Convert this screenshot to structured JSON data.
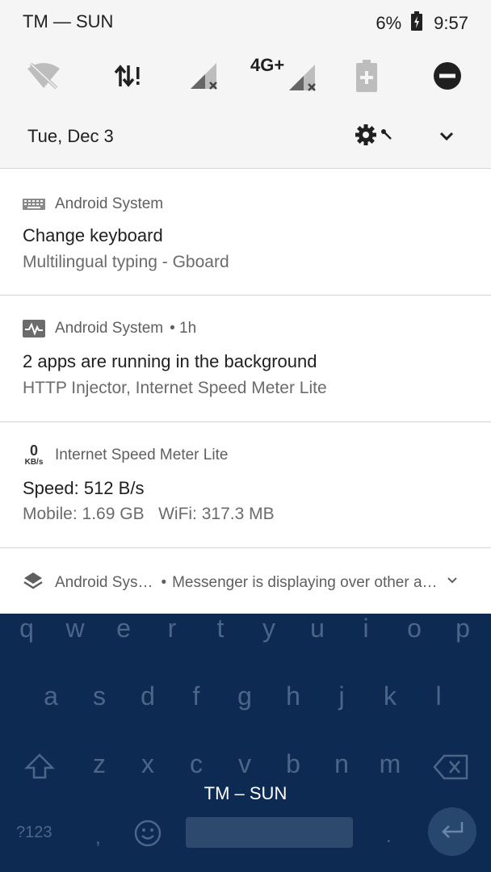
{
  "status_bar": {
    "carrier": "TM — SUN",
    "battery_percent": "6%",
    "time": "9:57"
  },
  "quick_settings": {
    "network_label": "4G+",
    "icons": [
      "wifi-off-icon",
      "data-transfer-icon",
      "signal-no-sim-icon",
      "signal-4g-icon",
      "battery-saver-icon",
      "do-not-disturb-icon"
    ]
  },
  "date_row": {
    "date": "Tue, Dec 3"
  },
  "notifications": [
    {
      "app": "Android System",
      "time": "",
      "title": "Change keyboard",
      "text": "Multilingual typing - Gboard",
      "icon": "keyboard-icon"
    },
    {
      "app": "Android System",
      "time": "• 1h",
      "title": "2 apps are running in the background",
      "text": "HTTP Injector, Internet Speed Meter Lite",
      "icon": "activity-icon"
    },
    {
      "app": "Internet Speed Meter Lite",
      "time": "",
      "title": "Speed: 512 B/s",
      "text": "Mobile: 1.69 GB   WiFi: 317.3 MB",
      "icon": "speed-icon",
      "icon_value": "0",
      "icon_unit": "KB/s"
    }
  ],
  "collapsed_notification": {
    "app": "Android Sys…",
    "separator": "•",
    "text": "Messenger is displaying over other a…",
    "icon": "layers-icon"
  },
  "keyboard": {
    "row1": [
      "q",
      "w",
      "e",
      "r",
      "t",
      "y",
      "u",
      "i",
      "o",
      "p"
    ],
    "row2": [
      "a",
      "s",
      "d",
      "f",
      "g",
      "h",
      "j",
      "k",
      "l"
    ],
    "row3": [
      "z",
      "x",
      "c",
      "v",
      "b",
      "n",
      "m"
    ],
    "symbols_key": "?123",
    "comma_key": ",",
    "period_key": ".",
    "toast": "TM – SUN"
  },
  "colors": {
    "shade_bg": "#f5f5f5",
    "card_bg": "#ffffff",
    "keyboard_bg": "#0c2a52",
    "key_text": "#4c6688"
  }
}
